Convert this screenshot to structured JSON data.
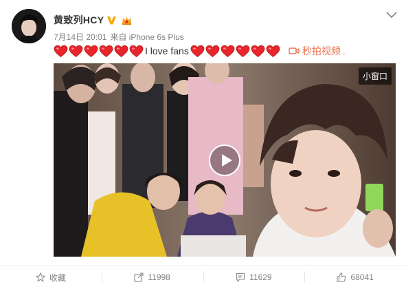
{
  "user": {
    "name": "黄致列HCY",
    "verified_icon": "verified-v-icon",
    "member_icon": "crown-icon"
  },
  "meta": {
    "date": "7月14日 20:01",
    "source": "来自 iPhone 6s Plus"
  },
  "post": {
    "leading_heart_count": 6,
    "text": "I love fans",
    "trailing_heart_count": 6,
    "video_link_label": "秒拍视频",
    "video_link_suffix": "."
  },
  "video": {
    "mini_window_label": "小窗口",
    "play_icon": "play-icon"
  },
  "actions": [
    {
      "icon": "star-icon",
      "label": "收藏"
    },
    {
      "icon": "share-icon",
      "label": "11998"
    },
    {
      "icon": "comment-icon",
      "label": "11629"
    },
    {
      "icon": "thumbs-up-icon",
      "label": "68041"
    }
  ],
  "colors": {
    "link": "#eb7350",
    "heart": "#e8252c",
    "verified": "#f7ab00",
    "muted": "#808080"
  }
}
